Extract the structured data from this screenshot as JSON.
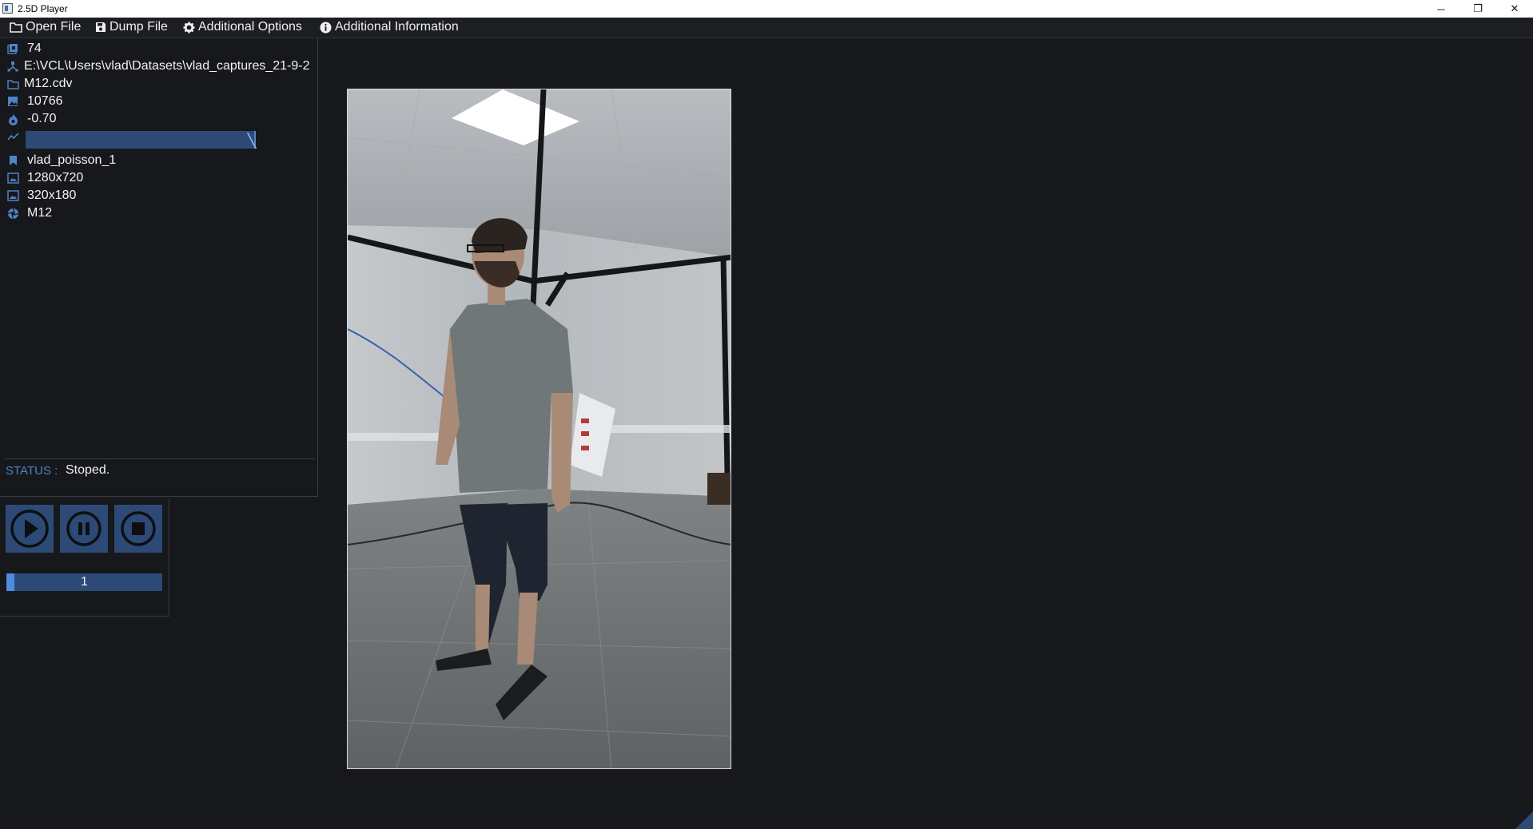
{
  "window": {
    "title": "2.5D Player",
    "minimize_glyph": "─",
    "maximize_glyph": "❐",
    "close_glyph": "✕"
  },
  "menu": {
    "open_file": "Open File",
    "dump_file": "Dump File",
    "additional_options": "Additional Options",
    "additional_information": "Additional Information"
  },
  "info": {
    "frame_count": "74",
    "path": "E:\\VCL\\Users\\vlad\\Datasets\\vlad_captures_21-9-2",
    "file_name": "M12.cdv",
    "frame_number": "10766",
    "temperature": "-0.70",
    "capture_name": "vlad_poisson_1",
    "color_resolution": "1280x720",
    "depth_resolution": "320x180",
    "device_name": "M12"
  },
  "icons": {
    "frame_count": "layers-icon",
    "path": "sitemap-icon",
    "file_name": "folder-icon",
    "frame_number": "image-icon",
    "temperature": "flame-icon",
    "range": "line-chart-icon",
    "capture_name": "bookmark-icon",
    "color_resolution": "picture-frame-icon",
    "depth_resolution": "picture-frame-icon",
    "device_name": "camera-shutter-icon"
  },
  "status": {
    "label": "STATUS :",
    "value": "Stoped."
  },
  "player": {
    "frame_value": "1"
  },
  "colors": {
    "accent": "#4f83c6",
    "control_bg": "#2c4a75",
    "background": "#16181c"
  }
}
